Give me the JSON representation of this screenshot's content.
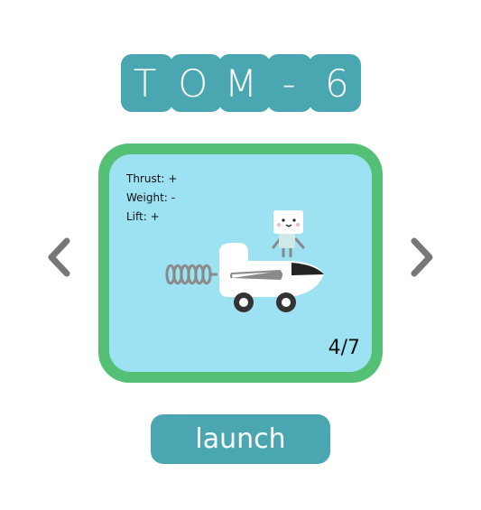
{
  "title": {
    "letters": [
      "T",
      "O",
      "M",
      "-",
      "6"
    ]
  },
  "vehicle": {
    "stats": [
      {
        "label": "Thrust:",
        "value": "+"
      },
      {
        "label": "Weight:",
        "value": "-"
      },
      {
        "label": "Lift:",
        "value": "+"
      }
    ],
    "counter": "4/7"
  },
  "nav": {
    "prev_icon": "chevron-left-icon",
    "next_icon": "chevron-right-icon"
  },
  "actions": {
    "launch_label": "launch"
  },
  "colors": {
    "accent": "#4aa6b1",
    "card_border": "#54c076",
    "card_bg": "#9de2f2",
    "arrow": "#777777"
  }
}
